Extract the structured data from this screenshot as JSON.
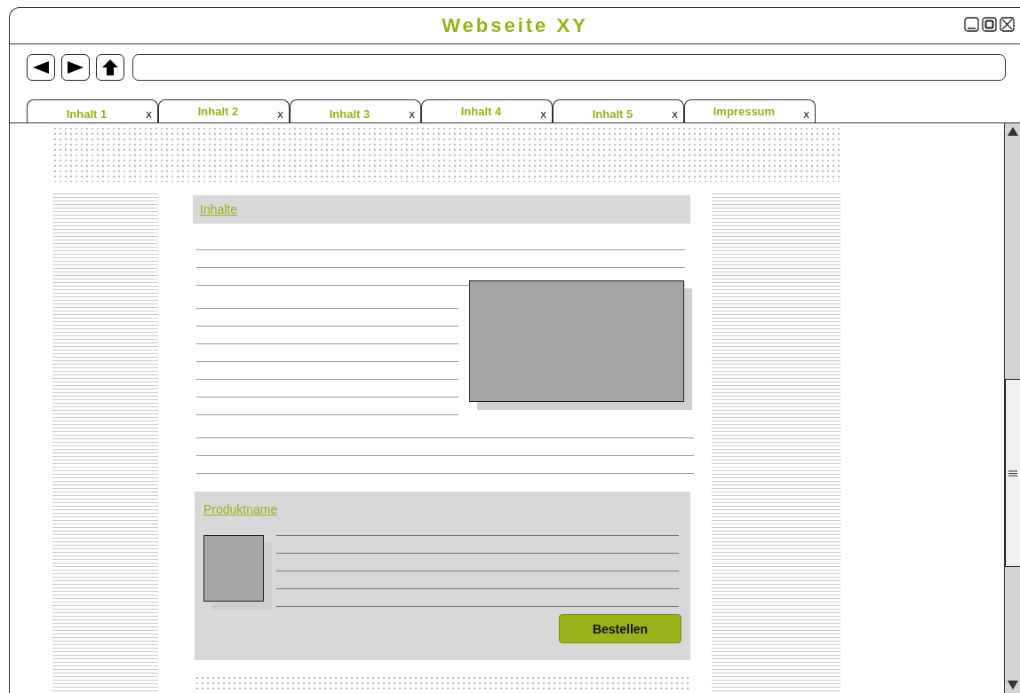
{
  "window": {
    "title": "Webseite XY"
  },
  "tabs": [
    {
      "label": "Inhalt 1",
      "close": "x"
    },
    {
      "label": "Inhalt 2",
      "close": "x"
    },
    {
      "label": "Inhalt 3",
      "close": "x"
    },
    {
      "label": "Inhalt 4",
      "close": "x"
    },
    {
      "label": "Inhalt 5",
      "close": "x"
    },
    {
      "label": "Impressum",
      "close": "x"
    }
  ],
  "content": {
    "heading": "Inhalte"
  },
  "product": {
    "name": "Produktname",
    "button": "Bestellen"
  }
}
